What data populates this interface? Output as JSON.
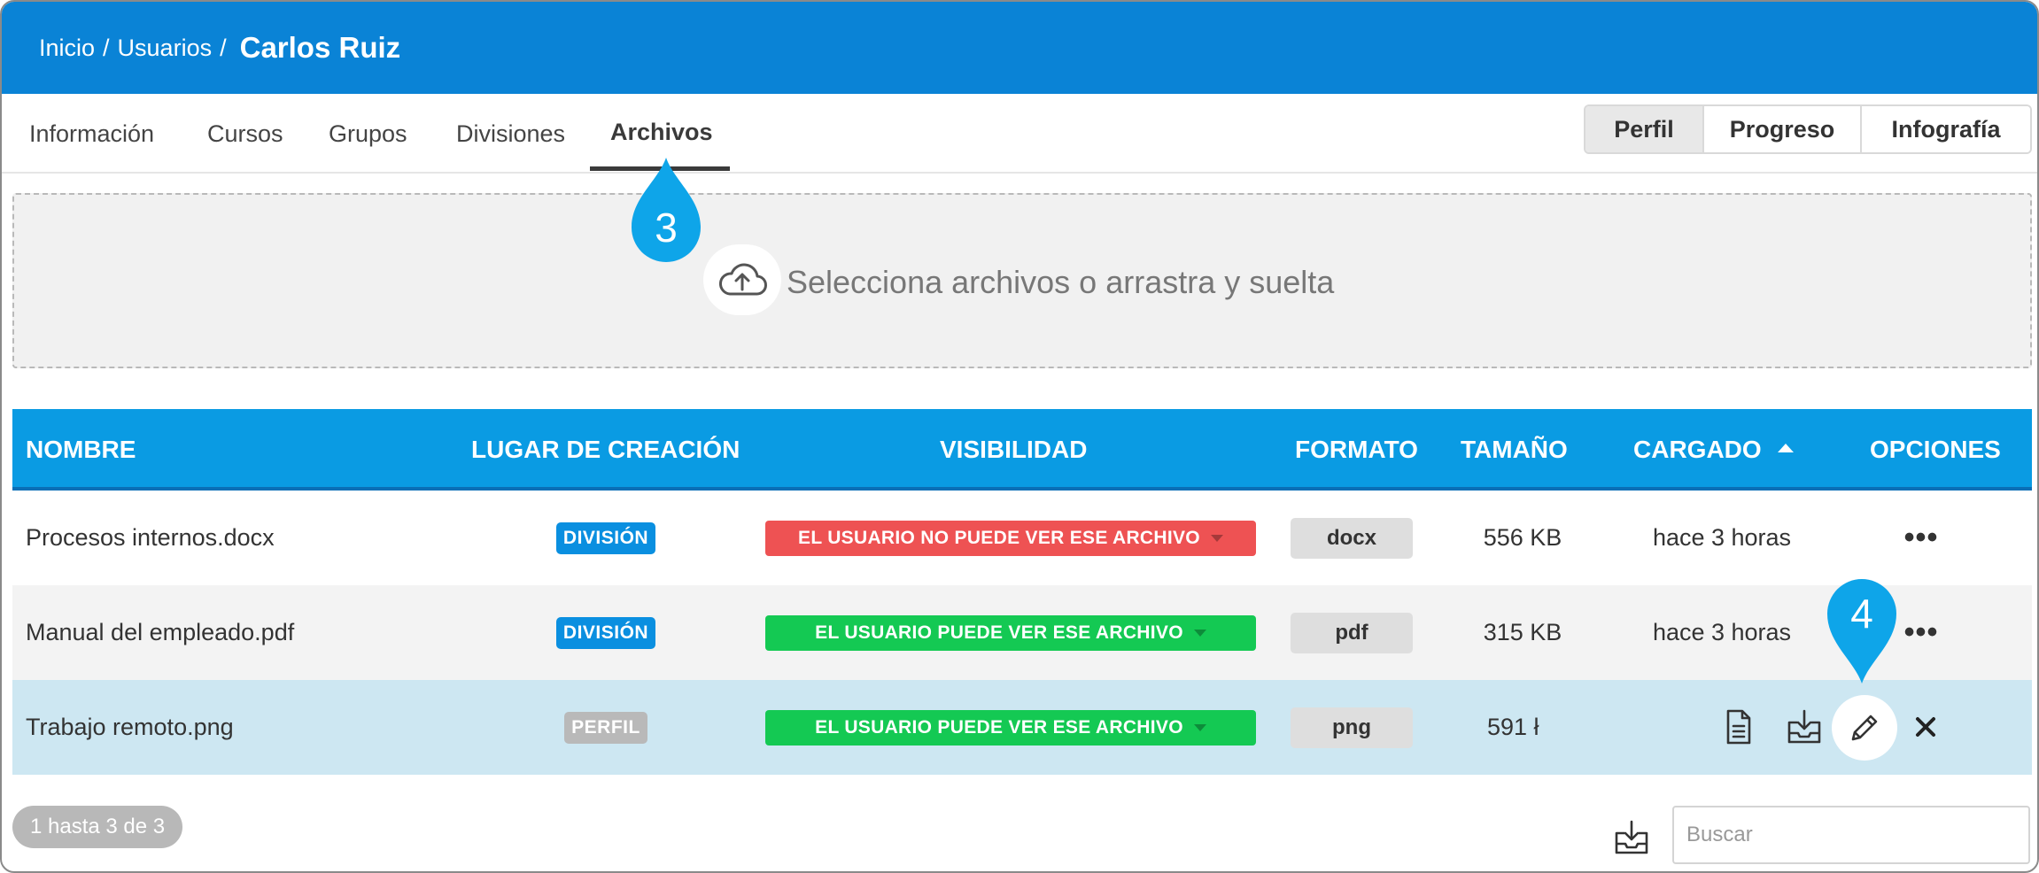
{
  "breadcrumb": {
    "home": "Inicio",
    "users": "Usuarios",
    "separator": "/",
    "current": "Carlos Ruiz"
  },
  "tabs": [
    {
      "label": "Información"
    },
    {
      "label": "Cursos"
    },
    {
      "label": "Grupos"
    },
    {
      "label": "Divisiones"
    },
    {
      "label": "Archivos",
      "active": true
    }
  ],
  "view_switch": [
    {
      "label": "Perfil",
      "active": true
    },
    {
      "label": "Progreso"
    },
    {
      "label": "Infografía"
    }
  ],
  "dropzone": {
    "text": "Selecciona archivos o arrastra y suelta",
    "icon": "cloud-upload-icon"
  },
  "markers": {
    "tab_marker": "3",
    "edit_marker": "4"
  },
  "table": {
    "headers": {
      "name": "NOMBRE",
      "place": "LUGAR DE CREACIÓN",
      "visibility": "VISIBILIDAD",
      "format": "FORMATO",
      "size": "TAMAÑO",
      "uploaded": "CARGADO",
      "options": "OPCIONES"
    },
    "sort": {
      "column": "uploaded",
      "direction": "ascending"
    },
    "rows": [
      {
        "name": "Procesos internos.docx",
        "place": "DIVISIÓN",
        "visibility": "EL USUARIO NO PUEDE VER ESE ARCHIVO",
        "format": "docx",
        "size": "556 KB",
        "uploaded": "hace 3 horas",
        "options": "•••"
      },
      {
        "name": "Manual del empleado.pdf",
        "place": "DIVISIÓN",
        "visibility": "EL USUARIO PUEDE VER ESE ARCHIVO",
        "format": "pdf",
        "size": "315 KB",
        "uploaded": "hace 3 horas",
        "options": "•••"
      },
      {
        "name": "Trabajo remoto.png",
        "place": "PERFIL",
        "visibility": "EL USUARIO PUEDE VER ESE ARCHIVO",
        "format": "png",
        "size": "591 ł",
        "uploaded": "",
        "options": ""
      }
    ],
    "row_actions": [
      "document-icon",
      "download-icon",
      "pencil-icon",
      "close-icon"
    ]
  },
  "footer": {
    "pagination": "1 hasta 3 de 3",
    "export_icon": "download-icon",
    "search_placeholder": "Buscar"
  },
  "colors": {
    "header": "#0a83d6",
    "table_header": "#0a9be3",
    "badge_blue": "#0a8fe0",
    "visibility_no": "#ee5253",
    "visibility_yes": "#14c953",
    "marker": "#0ea5e9",
    "highlight_row": "#cde7f2"
  }
}
